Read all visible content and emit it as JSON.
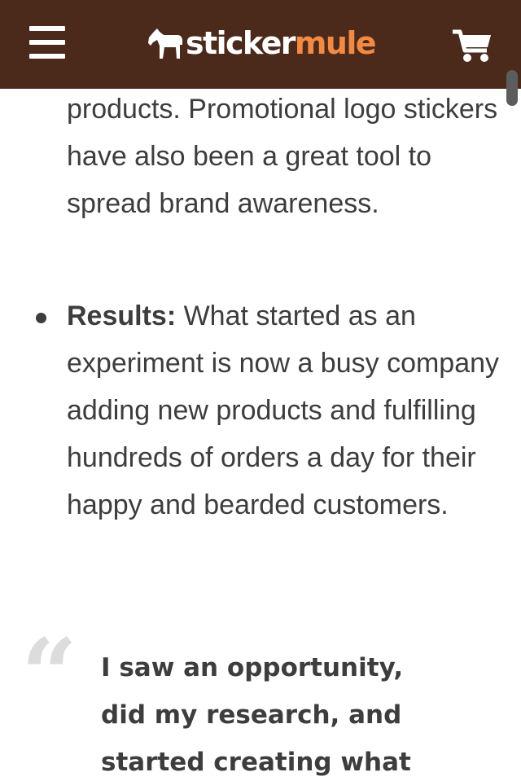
{
  "header": {
    "menu_icon": "hamburger-menu-icon",
    "logo": {
      "icon": "mule-icon",
      "text_part1": "sticker",
      "text_part2": "mule"
    },
    "cart_icon": "shopping-cart-icon"
  },
  "colors": {
    "header_bg": "#4b2a1c",
    "brand_orange": "#f28a43",
    "body_text": "#3d3d3d",
    "quote_mark": "#dcdcdc"
  },
  "content": {
    "paragraph_1": "products. Promotional logo stickers have also been a great tool to spread brand awareness.",
    "bullet": {
      "lead": "Results:",
      "text": " What started as an experiment is now a busy company adding new products and fulfilling hundreds of orders a day for their happy and bearded customers."
    },
    "quote": {
      "mark": "“",
      "text": "I saw an opportunity, did my research, and started creating what"
    }
  }
}
